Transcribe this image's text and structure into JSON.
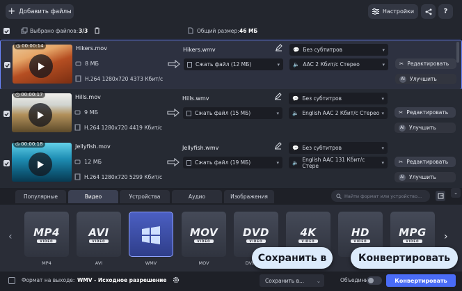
{
  "toolbar": {
    "add_files_label": "Добавить файлы",
    "settings_label": "Настройки",
    "help_label": "?"
  },
  "selection": {
    "selected_label": "Выбрано файлов:",
    "selected_count": "3/3",
    "total_size_label": "Общий размер:",
    "total_size": "46 МБ"
  },
  "files": [
    {
      "duration": "00:00:14",
      "name": "Hikers.mov",
      "size": "8 МБ",
      "info": "H.264 1280x720 4373 Кбит/с",
      "output_name": "Hikers.wmv",
      "compress": "Сжать файл (12 МБ)",
      "subtitles": "Без субтитров",
      "audio": "AAC 2 Кбит/с Стерео",
      "edit_label": "Редактировать",
      "enhance_label": "Улучшить",
      "selected": true
    },
    {
      "duration": "00:00:17",
      "name": "Hills.mov",
      "size": "9 МБ",
      "info": "H.264 1280x720 4419 Кбит/с",
      "output_name": "Hills.wmv",
      "compress": "Сжать файл (15 МБ)",
      "subtitles": "Без субтитров",
      "audio": "English AAC 2 Кбит/с Стерео",
      "edit_label": "Редактировать",
      "enhance_label": "Улучшить",
      "selected": false
    },
    {
      "duration": "00:00:18",
      "name": "Jellyfish.mov",
      "size": "12 МБ",
      "info": "H.264 1280x720 5299 Кбит/с",
      "output_name": "Jellyfish.wmv",
      "compress": "Сжать файл (19 МБ)",
      "subtitles": "Без субтитров",
      "audio": "English AAC 131 Кбит/с Стере",
      "edit_label": "Редактировать",
      "enhance_label": "Улучшить",
      "selected": false
    }
  ],
  "tabs": [
    "Популярные",
    "Видео",
    "Устройства",
    "Аудио",
    "Изображения"
  ],
  "active_tab": "Видео",
  "format_search_placeholder": "Найти формат или устройство...",
  "formats": [
    {
      "big": "MP4",
      "sub": "VIDEO",
      "label": "MP4"
    },
    {
      "big": "AVI",
      "sub": "VIDEO",
      "label": "AVI"
    },
    {
      "big": "",
      "sub": "",
      "label": "WMV",
      "icon": "windows-logo-icon"
    },
    {
      "big": "MOV",
      "sub": "VIDEO",
      "label": "MOV"
    },
    {
      "big": "DVD",
      "sub": "VIDEO",
      "label": "DVD-com"
    },
    {
      "big": "4K",
      "sub": "VIDEO",
      "label": ""
    },
    {
      "big": "HD",
      "sub": "VIDEO",
      "label": ""
    },
    {
      "big": "MPG",
      "sub": "VIDEO",
      "label": ""
    }
  ],
  "bottom": {
    "output_format_label": "Формат на выходе:",
    "output_format_value": "WMV - Исходное разрешение",
    "save_to_label": "Сохранить в...",
    "merge_label": "Объединить:",
    "convert_label": "Конвертировать"
  },
  "callouts": {
    "save_to": "Сохранить в",
    "convert": "Конвертировать"
  },
  "colors": {
    "accent": "#6b86ff",
    "callout_bg": "#dcebfb",
    "background": "#1b1d24"
  }
}
